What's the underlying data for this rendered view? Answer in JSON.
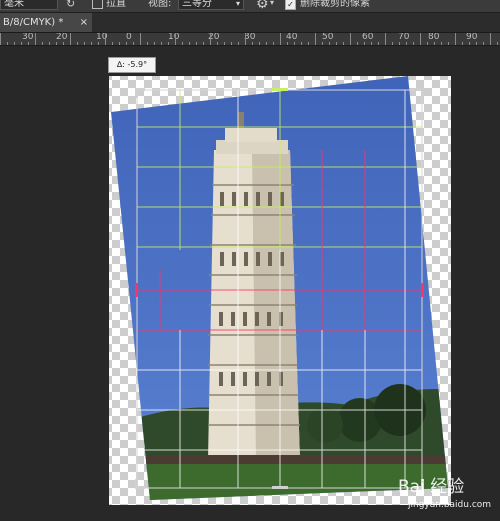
{
  "options_bar": {
    "unit_value": "毫米",
    "straighten_label": "拉直",
    "view_label": "视图:",
    "view_value": "三等分",
    "delete_cropped_label": "删除裁剪的像素"
  },
  "document_tab": {
    "title": "B/8/CMYK) *",
    "close_symbol": "×"
  },
  "ruler": {
    "labels": [
      "30",
      "20",
      "10",
      "0",
      "10",
      "20",
      "30",
      "40",
      "50",
      "60",
      "70",
      "80",
      "90"
    ]
  },
  "tooltip": {
    "text": "∆: -5.9°"
  },
  "watermark": {
    "text": "Bai 经验",
    "url": "jingyan.baidu.com"
  },
  "colors": {
    "sky": "#4a6fc2",
    "grass": "#3d6a2d",
    "grid_green": "#c8f064",
    "grid_red": "#ff3264",
    "grid_white": "#ffffff"
  },
  "icons": [
    "gear-icon",
    "checkbox-icon",
    "dropdown-arrow-icon",
    "refresh-icon"
  ]
}
